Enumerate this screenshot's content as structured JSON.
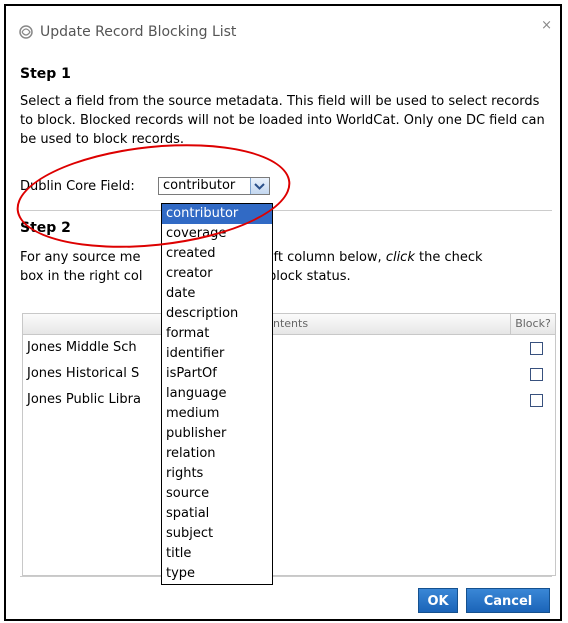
{
  "dialog": {
    "title": "Update Record Blocking List",
    "close_label": "×"
  },
  "step1": {
    "heading": "Step 1",
    "text": "Select a field from the source metadata. This field will be used to select records to block. Blocked records will not be loaded into WorldCat. Only one DC field can be used to block records."
  },
  "field_select": {
    "label": "Dublin Core Field:",
    "value": "contributor",
    "options": [
      "contributor",
      "coverage",
      "created",
      "creator",
      "date",
      "description",
      "format",
      "identifier",
      "isPartOf",
      "language",
      "medium",
      "publisher",
      "relation",
      "rights",
      "source",
      "spatial",
      "subject",
      "title",
      "type"
    ]
  },
  "step2": {
    "heading": "Step 2",
    "text_a": "For any source me",
    "text_b": "the left column below, ",
    "text_italic": "click",
    "text_c": " the check",
    "text_line2a": "box in the right col",
    "text_line2b": "the block status."
  },
  "table": {
    "header_contents": "ntents",
    "header_block": "Block?",
    "rows": [
      {
        "name": "Jones Middle Sch",
        "blocked": false
      },
      {
        "name": "Jones Historical S",
        "blocked": false
      },
      {
        "name": "Jones Public Libra",
        "blocked": false
      }
    ]
  },
  "buttons": {
    "ok": "OK",
    "cancel": "Cancel"
  },
  "colors": {
    "accent": "#1b64b8",
    "highlight": "#316ac5",
    "annotation": "#dd0000"
  }
}
